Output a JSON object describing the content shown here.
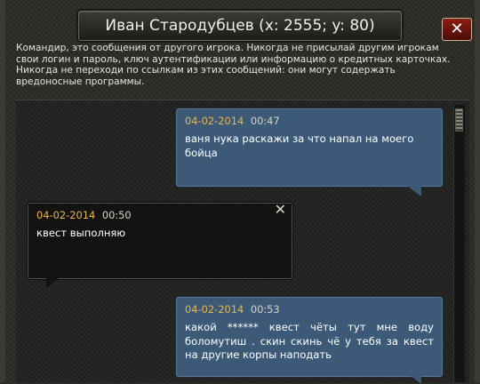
{
  "window": {
    "title": "Иван Стародубцев (x: 2555; y: 80)",
    "close_label": "✕"
  },
  "warning": "Командир, это сообщения от другого игрока. Никогда не присылай другим игрокам свои логин и пароль, ключ аутентификации или информацию о кредитных карточках. Никогда не переходи по ссылкам из этих сообщений: они могут содержать вредоносные программы.",
  "messages": [
    {
      "direction": "sent",
      "date": "04-02-2014",
      "time": "00:47",
      "text": "ваня нука раскажи за что напал на моего бойца"
    },
    {
      "direction": "received",
      "date": "04-02-2014",
      "time": "00:50",
      "text": "квест выполняю",
      "close_label": "✕"
    },
    {
      "direction": "sent",
      "date": "04-02-2014",
      "time": "00:53",
      "text": "какой ****** квест чёты тут мне воду боломутиш . скин скинь чё у тебя за квест на другие корпы наподать"
    }
  ],
  "colors": {
    "sent_bubble": "#3c5a77",
    "received_bubble": "#121211",
    "date_accent": "#e9b54b",
    "close_button": "#8a1e14"
  }
}
